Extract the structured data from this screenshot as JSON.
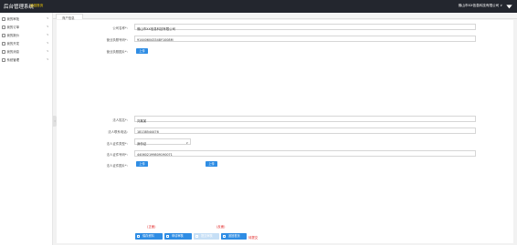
{
  "header": {
    "app_title": "后台管理系统",
    "badge": "返回首页",
    "company": "佛山市XX信息科技有限公司 ∨"
  },
  "sidebar": {
    "items": [
      {
        "label": "我的审批",
        "icon": "approval-icon"
      },
      {
        "label": "我的订单",
        "icon": "order-icon"
      },
      {
        "label": "我的报价",
        "icon": "quote-icon"
      },
      {
        "label": "我的开发",
        "icon": "dev-icon"
      },
      {
        "label": "我的消息",
        "icon": "message-icon"
      },
      {
        "label": "系统管理",
        "icon": "settings-icon"
      }
    ],
    "chevron": "∨"
  },
  "tabs": [
    {
      "label": "商户信息"
    }
  ],
  "form": {
    "company_name": {
      "label": "公司名称*：",
      "value": "佛山市XX信息科技有限公司"
    },
    "license_no": {
      "label": "营业执照号码*：",
      "value": "914406043348Y1008M"
    },
    "license_img": {
      "label": "营业执照图片*：",
      "button": "上传"
    },
    "legal_name": {
      "label": "法人姓名*：",
      "value": "刘某某"
    },
    "legal_phone": {
      "label": "法人联系电话：",
      "value": "18138544476"
    },
    "id_type": {
      "label": "法人证件类型*：",
      "value": "身份证",
      "caret": "∨"
    },
    "id_number": {
      "label": "法人证件号码*：",
      "value": "440602199809190071"
    },
    "id_img": {
      "label": "法人证件图片*：",
      "button1": "上传",
      "button2": "上传"
    }
  },
  "actions": {
    "note_left": "(正面)",
    "note_right": "(反面)",
    "save": "保存资料",
    "submit": "申请审核",
    "disabled": "提交审核",
    "back": "返回首页",
    "status": "待提交"
  },
  "colors": {
    "primary": "#2f8de4",
    "topbar": "#23262e",
    "danger": "#e02020"
  }
}
